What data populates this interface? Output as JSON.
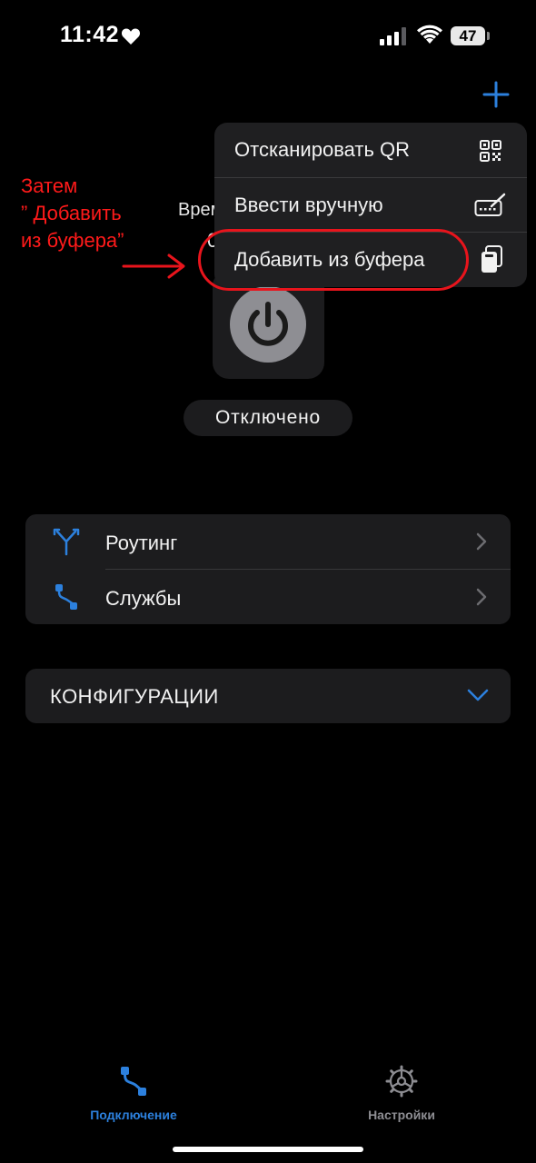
{
  "status_bar": {
    "time": "11:42",
    "battery": "47"
  },
  "behind_menu": {
    "partial_label": "Врем",
    "partial_value": "0"
  },
  "menu": {
    "items": [
      {
        "label": "Отсканировать QR",
        "icon": "qr-code-icon"
      },
      {
        "label": "Ввести вручную",
        "icon": "keyboard-pencil-icon"
      },
      {
        "label": "Добавить из буфера",
        "icon": "clipboard-icon"
      }
    ]
  },
  "annotation": {
    "lines": [
      "Затем",
      "” Добавить",
      "из буфера”"
    ],
    "color": "#ff1a1a"
  },
  "connection": {
    "status": "Отключено"
  },
  "list": {
    "items": [
      {
        "label": "Роутинг",
        "icon": "routing-fork-icon"
      },
      {
        "label": "Службы",
        "icon": "services-nodes-icon"
      }
    ]
  },
  "configs": {
    "label": "КОНФИГУРАЦИИ"
  },
  "tabbar": {
    "tabs": [
      {
        "label": "Подключение",
        "icon": "connection-nodes-icon",
        "active": true
      },
      {
        "label": "Настройки",
        "icon": "gear-icon",
        "active": false
      }
    ]
  },
  "colors": {
    "accent": "#2c80dd",
    "background": "#000000",
    "card": "#1c1c1e"
  }
}
